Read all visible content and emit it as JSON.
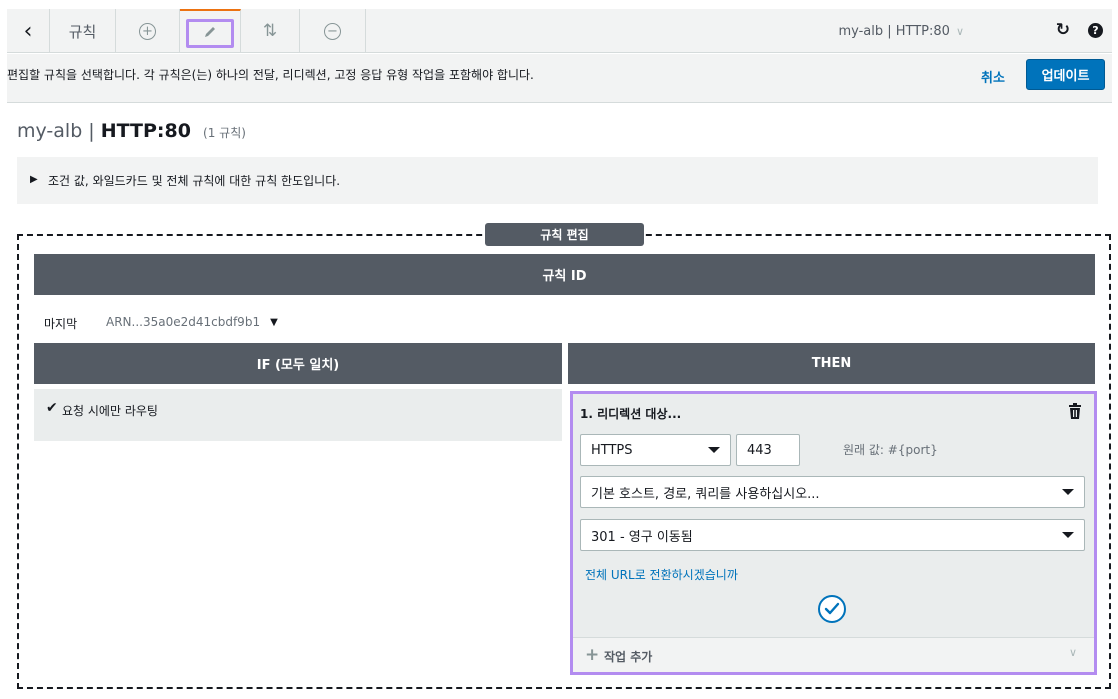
{
  "toolbar": {
    "back_icon": "chevron-left-icon",
    "title": "규칙",
    "add_icon": "plus-circle-icon",
    "edit_icon": "pencil-icon",
    "reorder_icon": "reorder-icon",
    "remove_icon": "minus-circle-icon",
    "listener": "my-alb | HTTP:80",
    "refresh_icon": "refresh-icon",
    "help_icon": "help-icon",
    "active_tab_color": "#ec7211"
  },
  "infobar": {
    "text": "편집할 규칙을 선택합니다. 각 규칙은(는) 하나의 전달, 리디렉션, 고정 응답 유형 작업을 포함해야 합니다.",
    "cancel_label": "취소",
    "update_label": "업데이트",
    "primary_color": "#0073bb"
  },
  "heading": {
    "lb_name": "my-alb |",
    "listener": "HTTP:80",
    "rule_count": "(1 규칙)"
  },
  "limits": {
    "text": "조건 값, 와일드카드 및 전체 규칙에 대한 규칙 한도입니다."
  },
  "editor": {
    "tag": "규칙 편집",
    "rule_id_header": "규칙 ID",
    "priority_label": "마지막",
    "arn": "ARN...35a0e2d41cbdf9b1",
    "if_header": "IF (모두 일치)",
    "then_header": "THEN",
    "condition": "요청 시에만 라우팅",
    "highlight_color": "#b38cf0"
  },
  "action": {
    "title": "1. 리디렉션 대상...",
    "protocol": "HTTPS",
    "port": "443",
    "original_value": "원래 값: #{port}",
    "host_select": "기본 호스트, 경로, 쿼리를 사용하십시오...",
    "status_select": "301 - 영구 이동됨",
    "full_url_link": "전체 URL로 전환하시겠습니까",
    "add_action": "작업 추가"
  }
}
